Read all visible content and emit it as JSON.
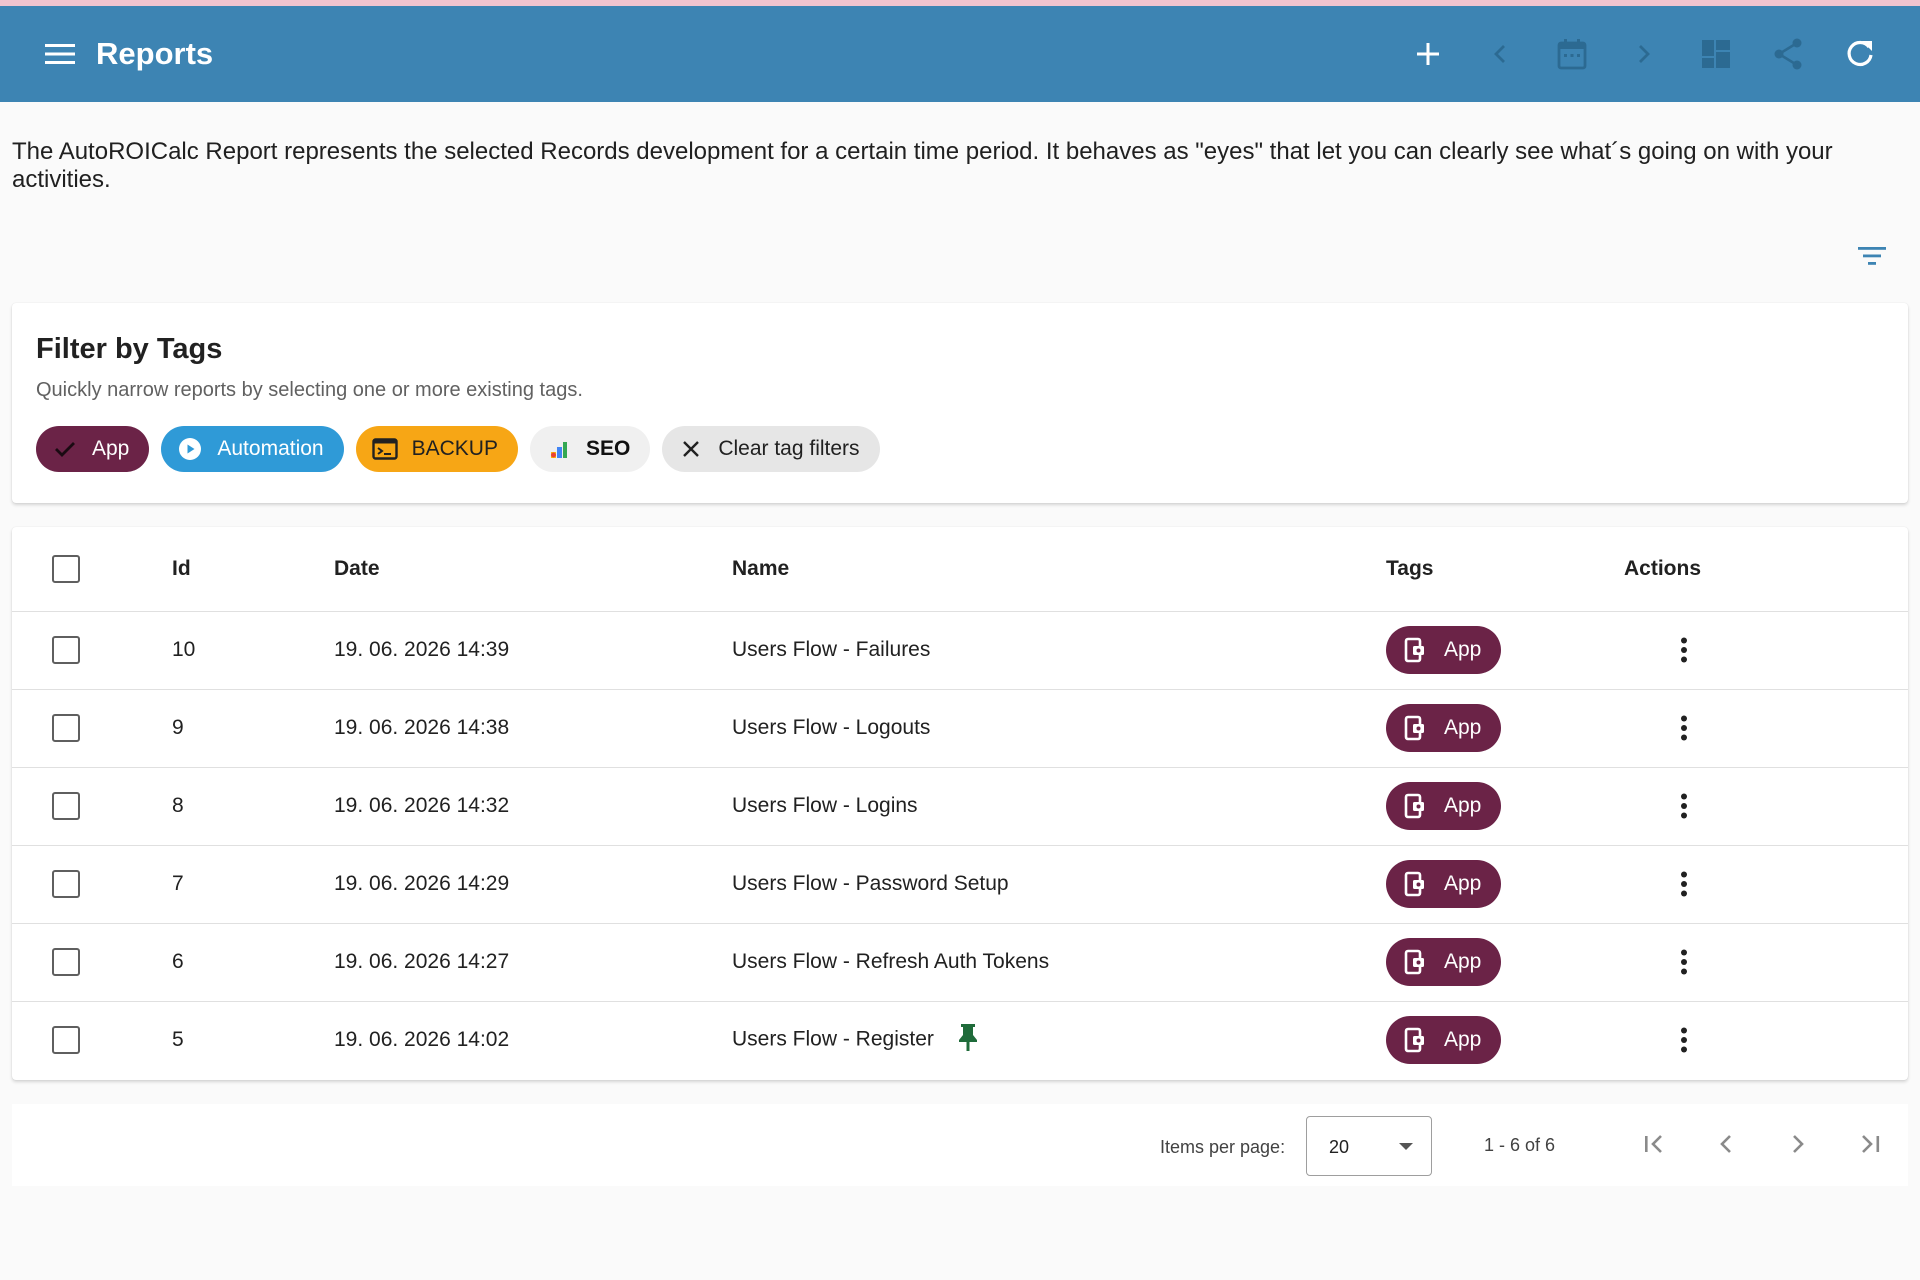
{
  "toolbar": {
    "title": "Reports",
    "icons": [
      "menu-icon",
      "add-icon",
      "chevron-left-icon",
      "calendar-icon",
      "chevron-right-icon",
      "dashboard-icon",
      "share-icon",
      "refresh-icon"
    ]
  },
  "intro": {
    "text": "The AutoROICalc Report represents the selected Records development for a certain time period. It behaves as \"eyes\" that let you can clearly see what´s going on with your activities."
  },
  "filter": {
    "title": "Filter by Tags",
    "subtitle": "Quickly narrow reports by selecting one or more existing tags.",
    "chips": [
      {
        "label": "App",
        "color": "#6b2347",
        "icon": "check-icon"
      },
      {
        "label": "Automation",
        "color": "#2f9ad7",
        "icon": "play-circle-icon"
      },
      {
        "label": "BACKUP",
        "color": "#f7a615",
        "icon": "terminal-icon"
      },
      {
        "label": "SEO",
        "color": "#f0f0f0",
        "icon": "analytics-icon"
      },
      {
        "label": "Clear tag filters",
        "color": "#e6e6e6",
        "icon": "close-icon"
      }
    ]
  },
  "table": {
    "headers": {
      "id": "Id",
      "date": "Date",
      "name": "Name",
      "tags": "Tags",
      "actions": "Actions"
    },
    "rows": [
      {
        "id": "10",
        "date": "19. 06. 2026 14:39",
        "name": "Users Flow - Failures",
        "tag": "App",
        "pinned": false
      },
      {
        "id": "9",
        "date": "19. 06. 2026 14:38",
        "name": "Users Flow - Logouts",
        "tag": "App",
        "pinned": false
      },
      {
        "id": "8",
        "date": "19. 06. 2026 14:32",
        "name": "Users Flow - Logins",
        "tag": "App",
        "pinned": false
      },
      {
        "id": "7",
        "date": "19. 06. 2026 14:29",
        "name": "Users Flow - Password Setup",
        "tag": "App",
        "pinned": false
      },
      {
        "id": "6",
        "date": "19. 06. 2026 14:27",
        "name": "Users Flow - Refresh Auth Tokens",
        "tag": "App",
        "pinned": false
      },
      {
        "id": "5",
        "date": "19. 06. 2026 14:02",
        "name": "Users Flow - Register",
        "tag": "App",
        "pinned": true
      }
    ]
  },
  "paginator": {
    "items_per_page_label": "Items per page:",
    "items_per_page_value": "20",
    "range": "1 - 6 of 6"
  },
  "colors": {
    "toolbar": "#3d84b3",
    "app_tag": "#6b2347",
    "pin": "#1f6b3a"
  }
}
